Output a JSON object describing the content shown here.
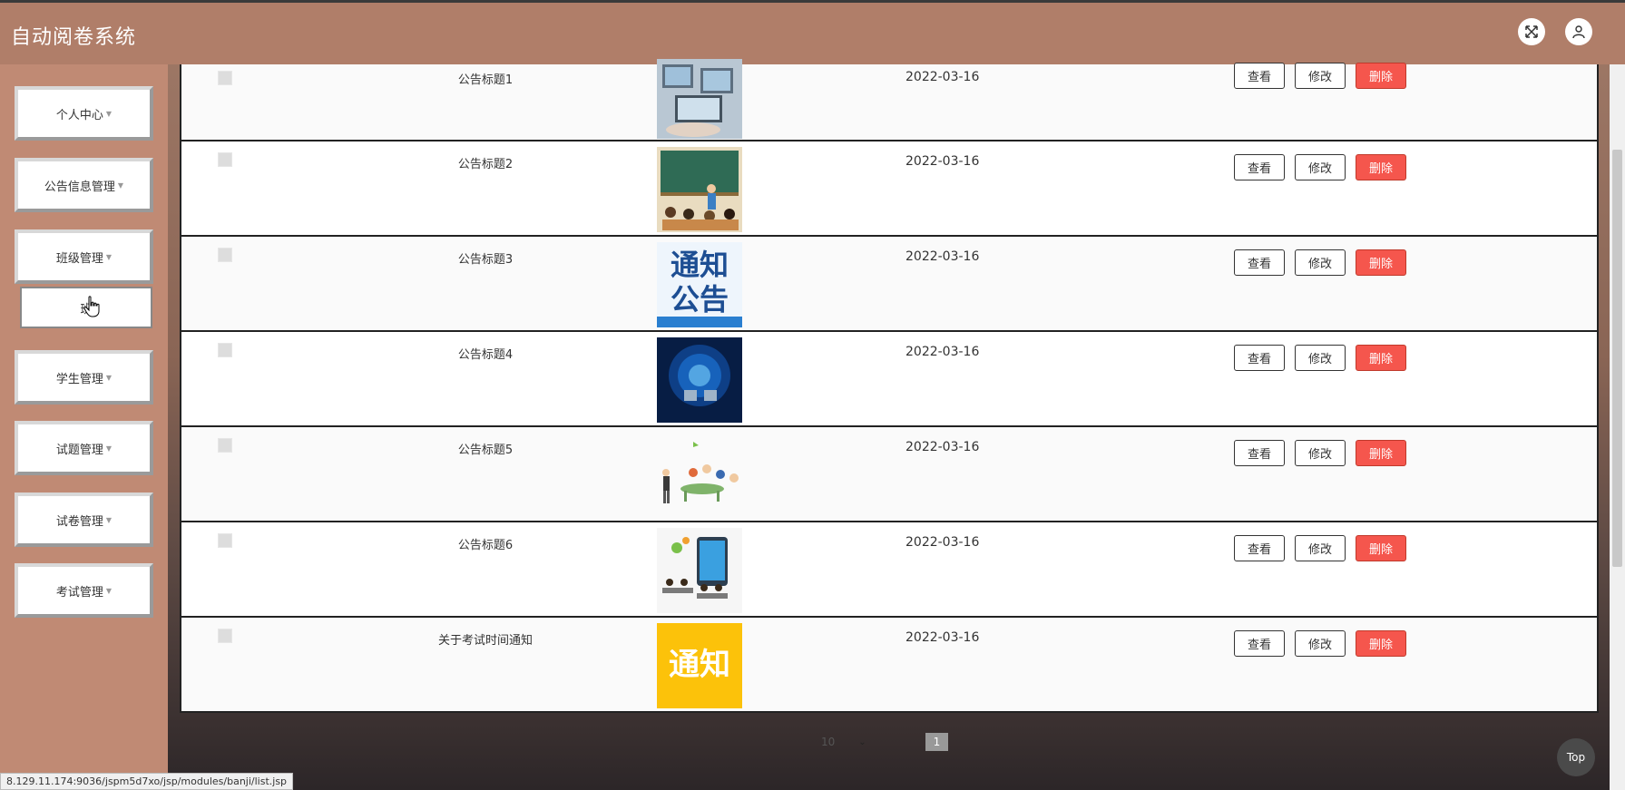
{
  "header": {
    "app_title": "自动阅卷系统",
    "fullscreen_icon": "fullscreen-icon",
    "user_icon": "user-icon"
  },
  "sidebar": {
    "items": [
      {
        "label": "个人中心"
      },
      {
        "label": "公告信息管理"
      },
      {
        "label": "班级管理"
      },
      {
        "label": "学生管理"
      },
      {
        "label": "试题管理"
      },
      {
        "label": "试卷管理"
      },
      {
        "label": "考试管理"
      }
    ],
    "submenu_label": "班"
  },
  "table": {
    "rows": [
      {
        "title": "公告标题1",
        "date": "2022-03-16",
        "image": "computer-lab-image"
      },
      {
        "title": "公告标题2",
        "date": "2022-03-16",
        "image": "classroom-report-image"
      },
      {
        "title": "公告标题3",
        "date": "2022-03-16",
        "image": "notice-announcement-image",
        "image_text": [
          "通知",
          "公告"
        ]
      },
      {
        "title": "公告标题4",
        "date": "2022-03-16",
        "image": "globe-network-image"
      },
      {
        "title": "公告标题5",
        "date": "2022-03-16",
        "image": "teacher-students-image"
      },
      {
        "title": "公告标题6",
        "date": "2022-03-16",
        "image": "online-class-image"
      },
      {
        "title": "关于考试时间通知",
        "date": "2022-03-16",
        "image": "notice-image",
        "image_text": [
          "通知"
        ]
      }
    ],
    "actions": {
      "view": "查看",
      "edit": "修改",
      "delete": "删除"
    }
  },
  "pagination": {
    "page_size": "10",
    "current_page": "1"
  },
  "top_button": "Top",
  "status_url": "8.129.11.174:9036/jspm5d7xo/jsp/modules/banji/list.jsp",
  "colors": {
    "header": "#b07e69",
    "delete_button": "#f5564d"
  }
}
